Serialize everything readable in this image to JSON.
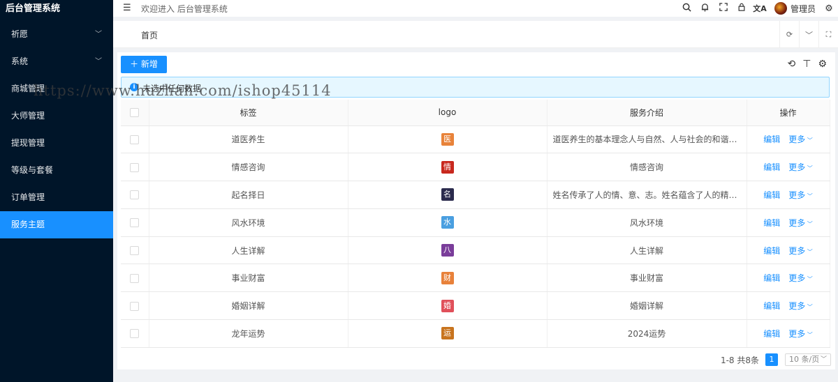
{
  "app": {
    "title": "后台管理系统"
  },
  "sidebar": {
    "items": [
      {
        "label": "祈愿",
        "has_children": true
      },
      {
        "label": "系统",
        "has_children": true
      },
      {
        "label": "商城管理",
        "has_children": false
      },
      {
        "label": "大师管理",
        "has_children": false
      },
      {
        "label": "提现管理",
        "has_children": false
      },
      {
        "label": "等级与套餐",
        "has_children": false
      },
      {
        "label": "订单管理",
        "has_children": false
      },
      {
        "label": "服务主题",
        "has_children": false,
        "active": true
      }
    ]
  },
  "header": {
    "welcome": "欢迎进入 后台管理系统",
    "user_name": "管理员"
  },
  "tabs": {
    "home": "首页"
  },
  "toolbar": {
    "add_label": "新增"
  },
  "alert": {
    "text": "未选中任何数据"
  },
  "table": {
    "columns": [
      "标签",
      "logo",
      "服务介绍",
      "操作"
    ],
    "rows": [
      {
        "tag": "道医养生",
        "logo_char": "医",
        "logo_color": "#e8833a",
        "desc": "道医养生的基本理念人与自然、人与社会的和谐相处。...",
        "edit": "编辑",
        "more": "更多"
      },
      {
        "tag": "情感咨询",
        "logo_char": "情",
        "logo_color": "#c8281e",
        "desc": "情感咨询",
        "edit": "编辑",
        "more": "更多"
      },
      {
        "tag": "起名择日",
        "logo_char": "名",
        "logo_color": "#2b2b4d",
        "desc": "姓名传承了人的情、意、志。姓名蕴含了人的精、气、...",
        "edit": "编辑",
        "more": "更多"
      },
      {
        "tag": "风水环境",
        "logo_char": "水",
        "logo_color": "#4a9fe0",
        "desc": "风水环境",
        "edit": "编辑",
        "more": "更多"
      },
      {
        "tag": "人生详解",
        "logo_char": "八",
        "logo_color": "#7a3d9a",
        "desc": "人生详解",
        "edit": "编辑",
        "more": "更多"
      },
      {
        "tag": "事业财富",
        "logo_char": "财",
        "logo_color": "#e8813a",
        "desc": "事业财富",
        "edit": "编辑",
        "more": "更多"
      },
      {
        "tag": "婚姻详解",
        "logo_char": "婚",
        "logo_color": "#e0505a",
        "desc": "婚姻详解",
        "edit": "编辑",
        "more": "更多"
      },
      {
        "tag": "龙年运势",
        "logo_char": "运",
        "logo_color": "#c8741e",
        "desc": "2024运势",
        "edit": "编辑",
        "more": "更多"
      }
    ]
  },
  "pagination": {
    "summary": "1-8 共8条",
    "current_page": "1",
    "page_size": "10 条/页"
  },
  "watermark": {
    "text": "https://www.huzhan.com/ishop45114"
  },
  "colors": {
    "sidebar_bg": "#001529",
    "accent": "#1890ff"
  }
}
